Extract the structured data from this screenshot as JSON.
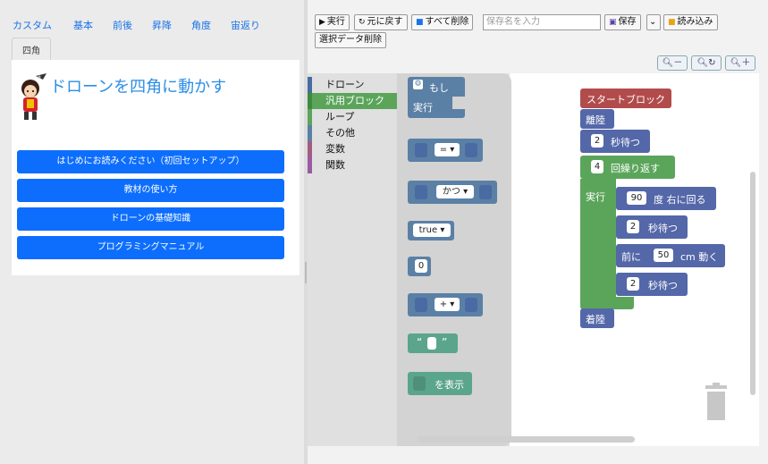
{
  "left": {
    "tabs": [
      "カスタム",
      "基本",
      "前後",
      "昇降",
      "角度",
      "宙返り"
    ],
    "subtab": "四角",
    "title": "ドローンを四角に動かす",
    "buttons": [
      "はじめにお読みください（初回セットアップ）",
      "教材の使い方",
      "ドローンの基礎知識",
      "プログラミングマニュアル"
    ]
  },
  "toolbar": {
    "run": "実行",
    "undo": "元に戻す",
    "delete_all": "すべて削除",
    "name_placeholder": "保存名を入力",
    "save": "保存",
    "load": "読み込み",
    "delete_selected": "選択データ削除"
  },
  "zoom": {
    "out": "－",
    "reset": "↻",
    "in": "＋"
  },
  "categories": [
    {
      "label": "ドローン",
      "color": "#4a6aa3"
    },
    {
      "label": "汎用ブロック",
      "color": "#5ba55b"
    },
    {
      "label": "ループ",
      "color": "#5ba55b"
    },
    {
      "label": "その他",
      "color": "#5b80a5"
    },
    {
      "label": "変数",
      "color": "#a55b80"
    },
    {
      "label": "関数",
      "color": "#995ba5"
    }
  ],
  "flyout": {
    "if_label": "もし",
    "do_label": "実行",
    "eq": "=",
    "and": "かつ",
    "true": "true",
    "zero": "0",
    "plus": "+",
    "quote_open": "“",
    "quote_close": "”",
    "print": "を表示"
  },
  "program": {
    "start": "スタートブロック",
    "takeoff": "離陸",
    "wait1_value": "2",
    "wait_label": "秒待つ",
    "repeat_value": "4",
    "repeat_label": "回繰り返す",
    "do_label": "実行",
    "turn_value": "90",
    "turn_label": "度 右に回る",
    "wait2_value": "2",
    "forward_prefix": "前に",
    "forward_value": "50",
    "forward_label": "cm 動く",
    "wait3_value": "2",
    "land": "着陸"
  },
  "colors": {
    "start": "#b24b4b",
    "drone": "#5467a8",
    "loop": "#5ba55b",
    "logic": "#5b80a5",
    "text": "#5ba58c",
    "button_blue": "#0d6efd"
  }
}
